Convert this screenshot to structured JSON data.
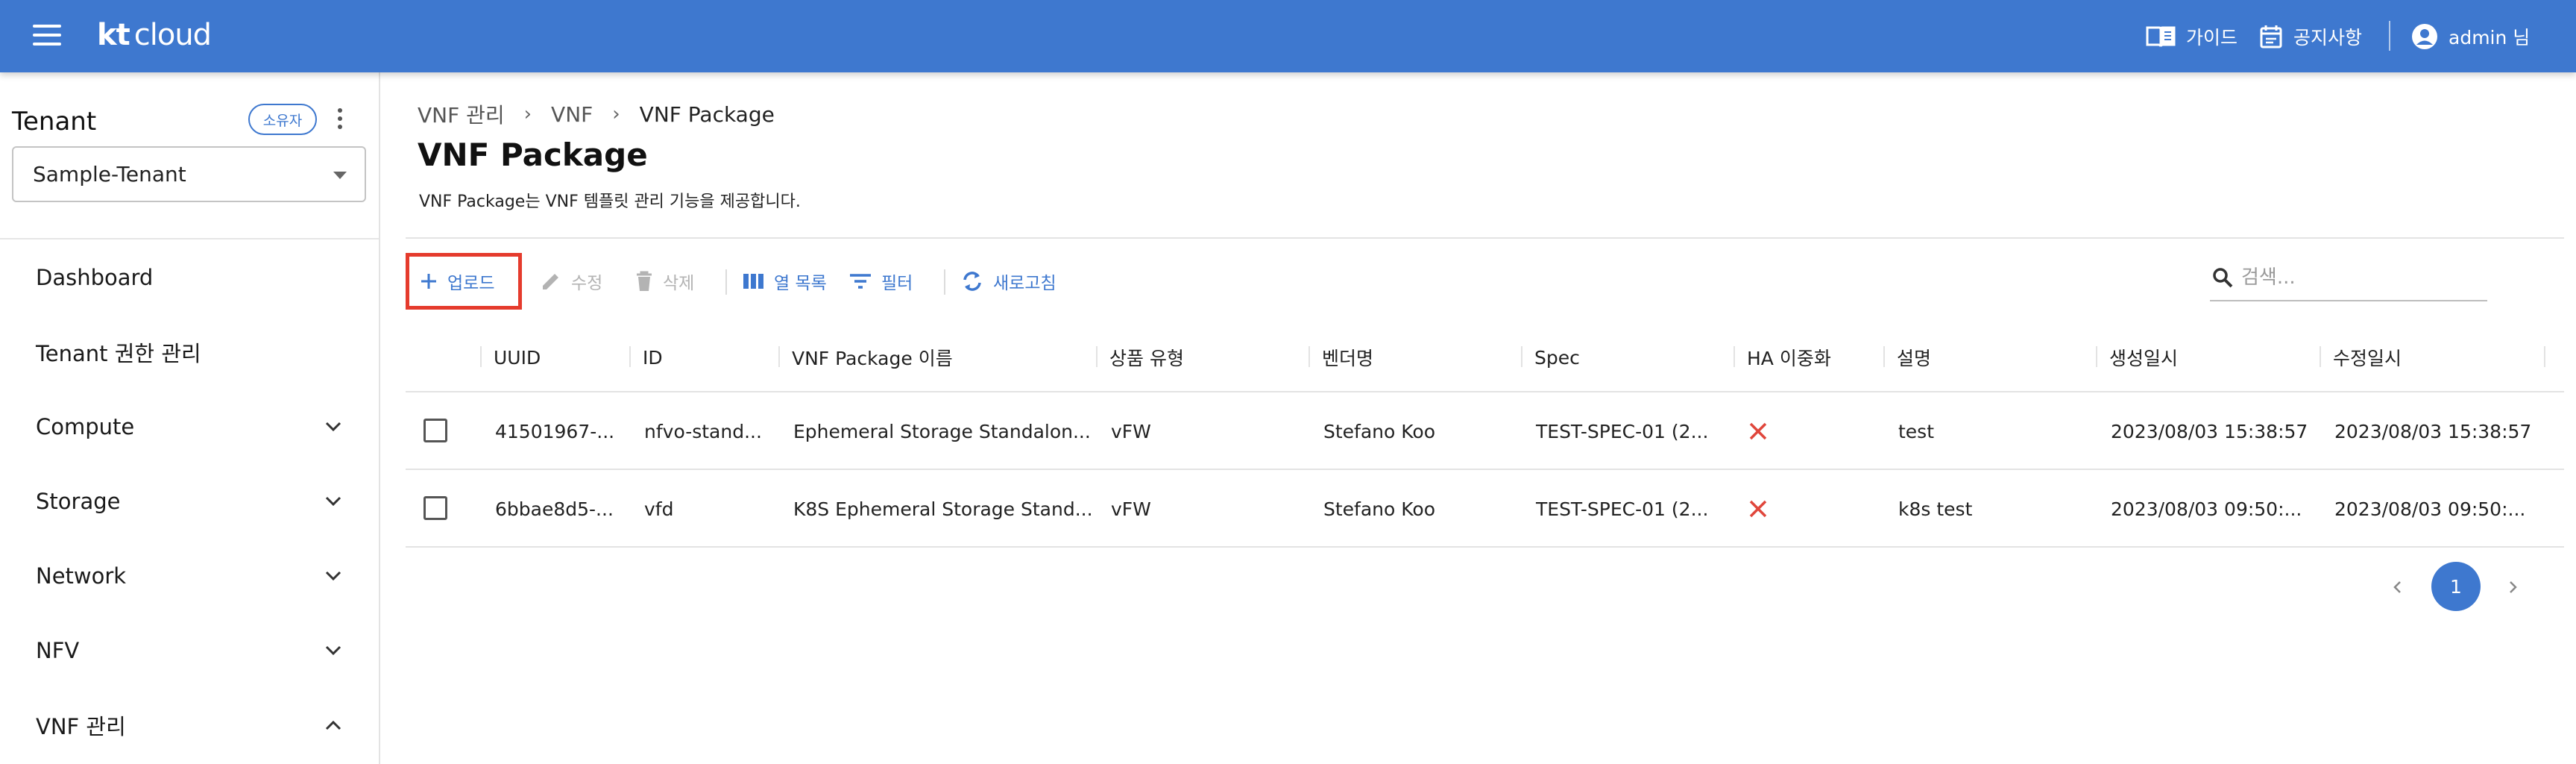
{
  "header": {
    "brand_kt": "kt",
    "brand_cloud": "cloud",
    "guide": "가이드",
    "notice": "공지사항",
    "user": "admin 님",
    "bg_color": "#3e78cf"
  },
  "sidebar": {
    "tenant_label": "Tenant",
    "owner_badge": "소유자",
    "tenant_selected": "Sample-Tenant",
    "items": [
      {
        "label": "Dashboard",
        "expandable": false
      },
      {
        "label": "Tenant 권한 관리",
        "expandable": false
      },
      {
        "label": "Compute",
        "expandable": true,
        "expanded": false
      },
      {
        "label": "Storage",
        "expandable": true,
        "expanded": false
      },
      {
        "label": "Network",
        "expandable": true,
        "expanded": false
      },
      {
        "label": "NFV",
        "expandable": true,
        "expanded": false
      },
      {
        "label": "VNF 관리",
        "expandable": true,
        "expanded": true
      }
    ]
  },
  "breadcrumb": [
    "VNF 관리",
    "VNF",
    "VNF Package"
  ],
  "page": {
    "title": "VNF Package",
    "description": "VNF Package는 VNF 템플릿 관리 기능을 제공합니다."
  },
  "toolbar": {
    "upload": "업로드",
    "edit": "수정",
    "delete": "삭제",
    "columns": "열 목록",
    "filter": "필터",
    "refresh": "새로고침"
  },
  "search": {
    "placeholder": "검색..."
  },
  "table": {
    "columns": [
      "UUID",
      "ID",
      "VNF Package 이름",
      "상품 유형",
      "벤더명",
      "Spec",
      "HA 이중화",
      "설명",
      "생성일시",
      "수정일시"
    ],
    "rows": [
      {
        "uuid": "41501967-...",
        "id": "nfvo-stand...",
        "name": "Ephemeral Storage Standalon...",
        "type": "vFW",
        "vendor": "Stefano Koo",
        "spec": "TEST-SPEC-01 (2...",
        "ha": false,
        "desc": "test",
        "created": "2023/08/03 15:38:57",
        "modified": "2023/08/03 15:38:57"
      },
      {
        "uuid": "6bbae8d5-...",
        "id": "vfd",
        "name": "K8S Ephemeral Storage Stand...",
        "type": "vFW",
        "vendor": "Stefano Koo",
        "spec": "TEST-SPEC-01 (2...",
        "ha": false,
        "desc": "k8s test",
        "created": "2023/08/03 09:50:...",
        "modified": "2023/08/03 09:50:..."
      }
    ]
  },
  "pagination": {
    "current": "1"
  },
  "colors": {
    "accent": "#3e78cf",
    "highlight": "#e53b2d",
    "ha_false": "#e0463b"
  }
}
